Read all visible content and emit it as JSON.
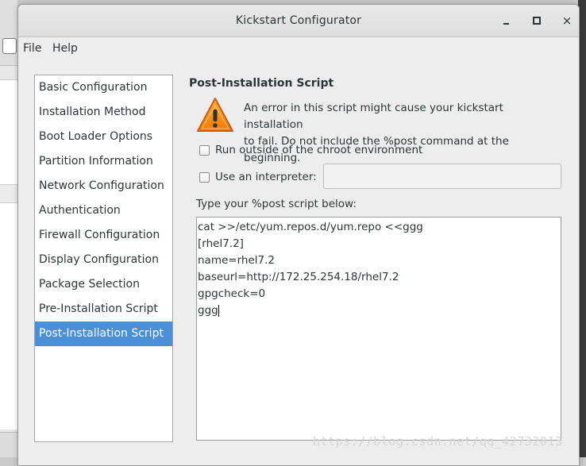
{
  "window": {
    "title": "Kickstart Configurator",
    "controls": {
      "minimize": "minimize-icon",
      "maximize": "maximize-icon",
      "close": "×"
    }
  },
  "menubar": {
    "items": [
      "File",
      "Help"
    ]
  },
  "sidebar": {
    "items": [
      {
        "label": "Basic Configuration"
      },
      {
        "label": "Installation Method"
      },
      {
        "label": "Boot Loader Options"
      },
      {
        "label": "Partition Information"
      },
      {
        "label": "Network Configuration"
      },
      {
        "label": "Authentication"
      },
      {
        "label": "Firewall Configuration"
      },
      {
        "label": "Display Configuration"
      },
      {
        "label": "Package Selection"
      },
      {
        "label": "Pre-Installation Script"
      },
      {
        "label": "Post-Installation Script"
      }
    ],
    "selected_index": 10
  },
  "main": {
    "section_title": "Post-Installation Script",
    "warning_icon": "warning-icon",
    "warning_text_line1": "An error in this script might cause your kickstart installation",
    "warning_text_line2": "to fail. Do not include the %post command at the beginning.",
    "run_outside_chroot_label": "Run outside of the chroot environment",
    "run_outside_chroot_checked": false,
    "use_interpreter_label": "Use an interpreter:",
    "use_interpreter_checked": false,
    "interpreter_value": "",
    "script_prompt": "Type your %post script below:",
    "script_lines": [
      "cat >>/etc/yum.repos.d/yum.repo <<ggg",
      "[rhel7.2]",
      "name=rhel7.2",
      "baseurl=http://172.25.254.18/rhel7.2",
      "gpgcheck=0",
      "ggg"
    ]
  },
  "watermark": "https://blog.csdn.net/qq_42732013",
  "colors": {
    "selection": "#4a90d9",
    "warning_orange": "#f57900"
  }
}
